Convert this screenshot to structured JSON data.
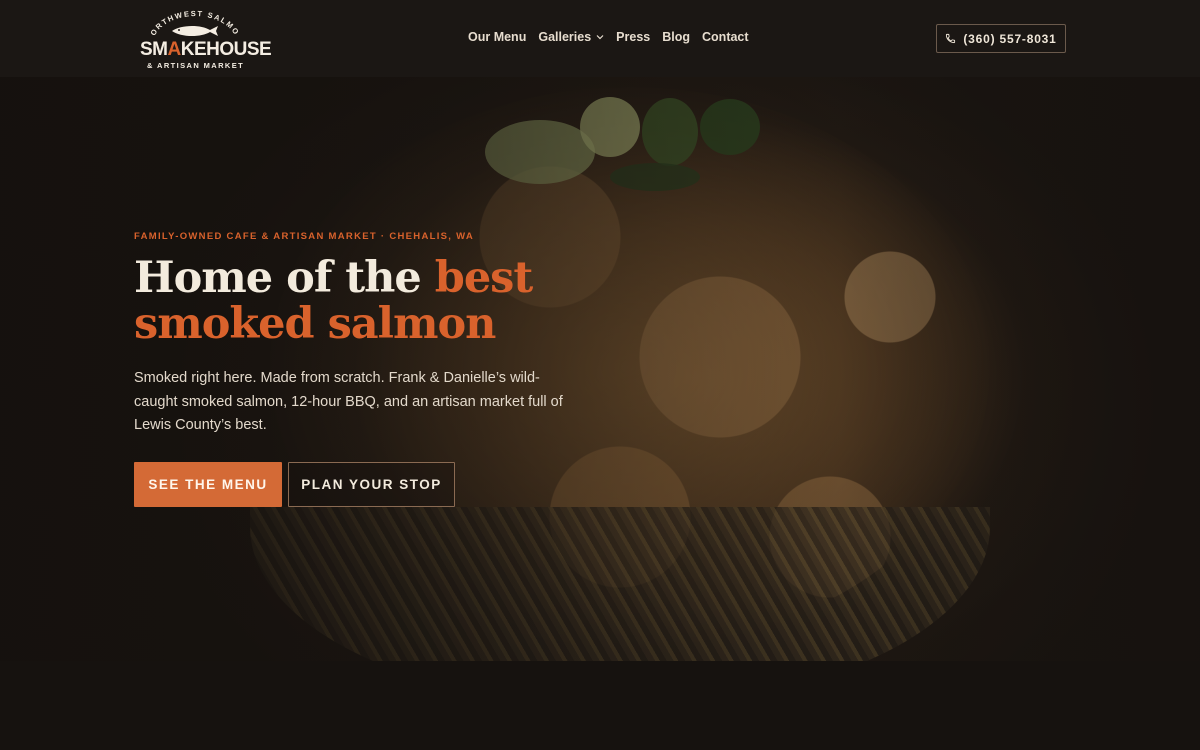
{
  "brand": {
    "arc_text": "NORTHWEST SALMON",
    "wordmark_part1": "SM",
    "wordmark_flame": "A",
    "wordmark_part2": "KEHOUSE",
    "tagline": "& ARTISAN MARKET"
  },
  "nav": {
    "items": [
      {
        "label": "Our Menu"
      },
      {
        "label": "Galleries",
        "has_dropdown": true
      },
      {
        "label": "Press"
      },
      {
        "label": "Blog"
      },
      {
        "label": "Contact"
      }
    ]
  },
  "phone": {
    "label": "(360) 557-8031",
    "icon": "phone-icon"
  },
  "hero": {
    "eyebrow": "FAMILY-OWNED CAFE & ARTISAN MARKET · CHEHALIS, WA",
    "headline_plain": "Home of the ",
    "headline_accent": "best smoked salmon",
    "body": "Smoked right here. Made from scratch. Frank & Danielle’s wild-caught smoked salmon, 12-hour BBQ, and an artisan market full of Lewis County’s best.",
    "primary_cta": "SEE THE MENU",
    "secondary_cta": "PLAN YOUR STOP",
    "image": "mac-and-cheese-bowl-photo"
  },
  "colors": {
    "accent": "#d9622c",
    "button_primary": "#d46a36",
    "background": "#16120f",
    "header": "#1b1714",
    "text_light": "#f3ebdd"
  }
}
